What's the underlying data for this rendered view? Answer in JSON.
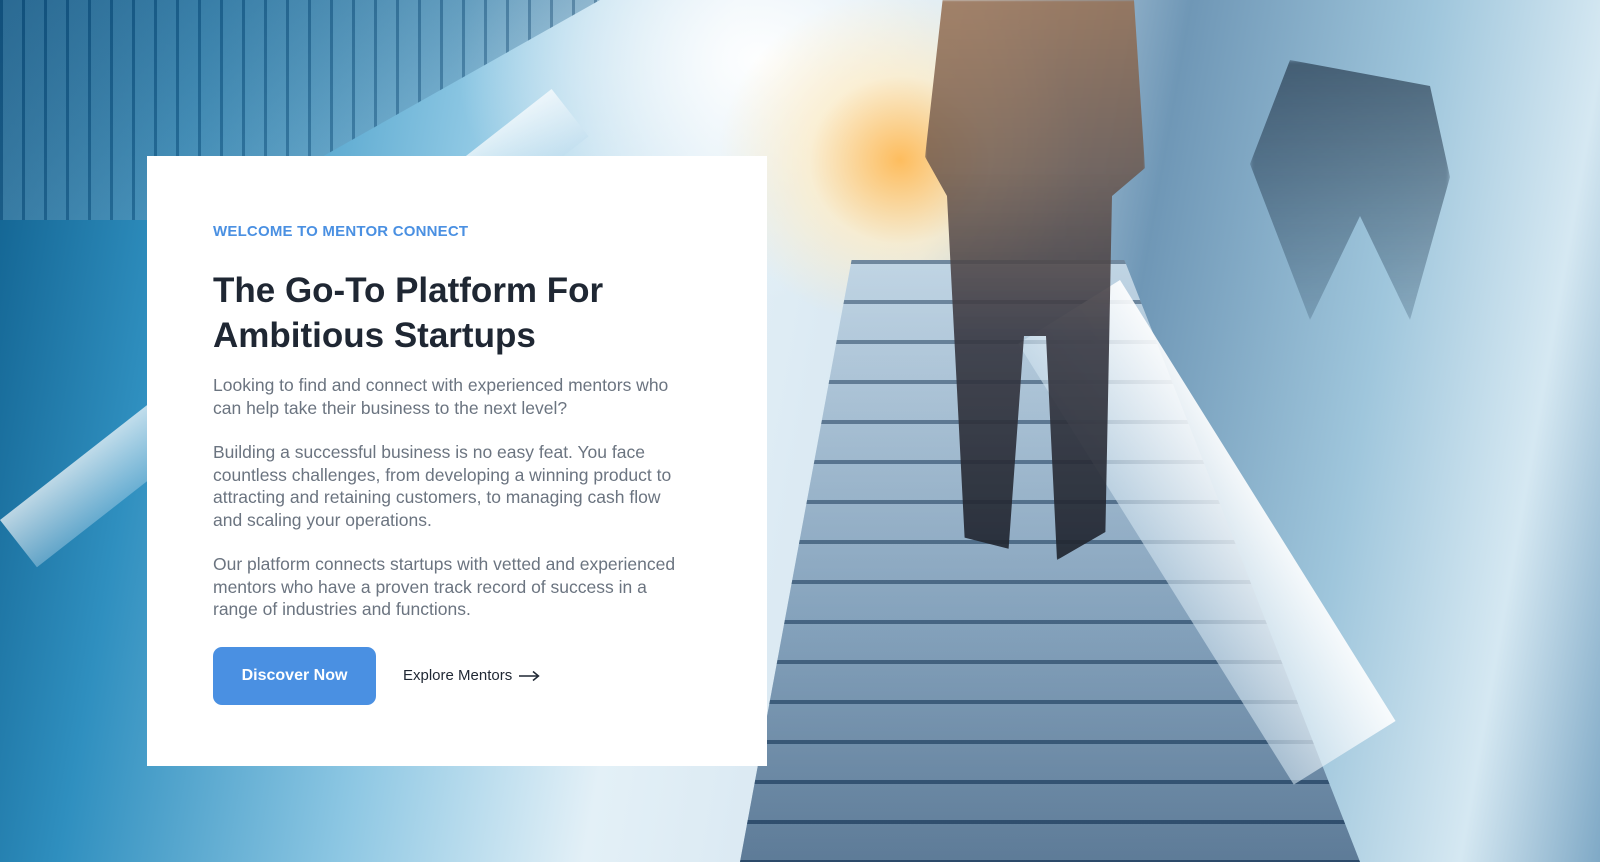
{
  "hero": {
    "eyebrow": "WELCOME TO MENTOR CONNECT",
    "title": "The Go-To Platform For Ambitious Startups",
    "paragraphs": [
      "Looking to find and connect with experienced mentors who can help take their business to the next level?",
      "Building a successful business is no easy feat. You face countless challenges, from developing a winning product to attracting and retaining customers, to managing cash flow and scaling your operations.",
      "Our platform connects startups with vetted and experienced mentors who have a proven track record of success in a range of industries and functions."
    ],
    "primary_button": "Discover Now",
    "secondary_link": "Explore Mentors",
    "secondary_icon": "arrow-right-icon"
  },
  "background": {
    "image": "escalator-businessman-photo"
  },
  "colors": {
    "accent": "#4a90e2",
    "heading": "#1f2733",
    "body_text": "#6b7480",
    "card_bg": "#ffffff"
  }
}
